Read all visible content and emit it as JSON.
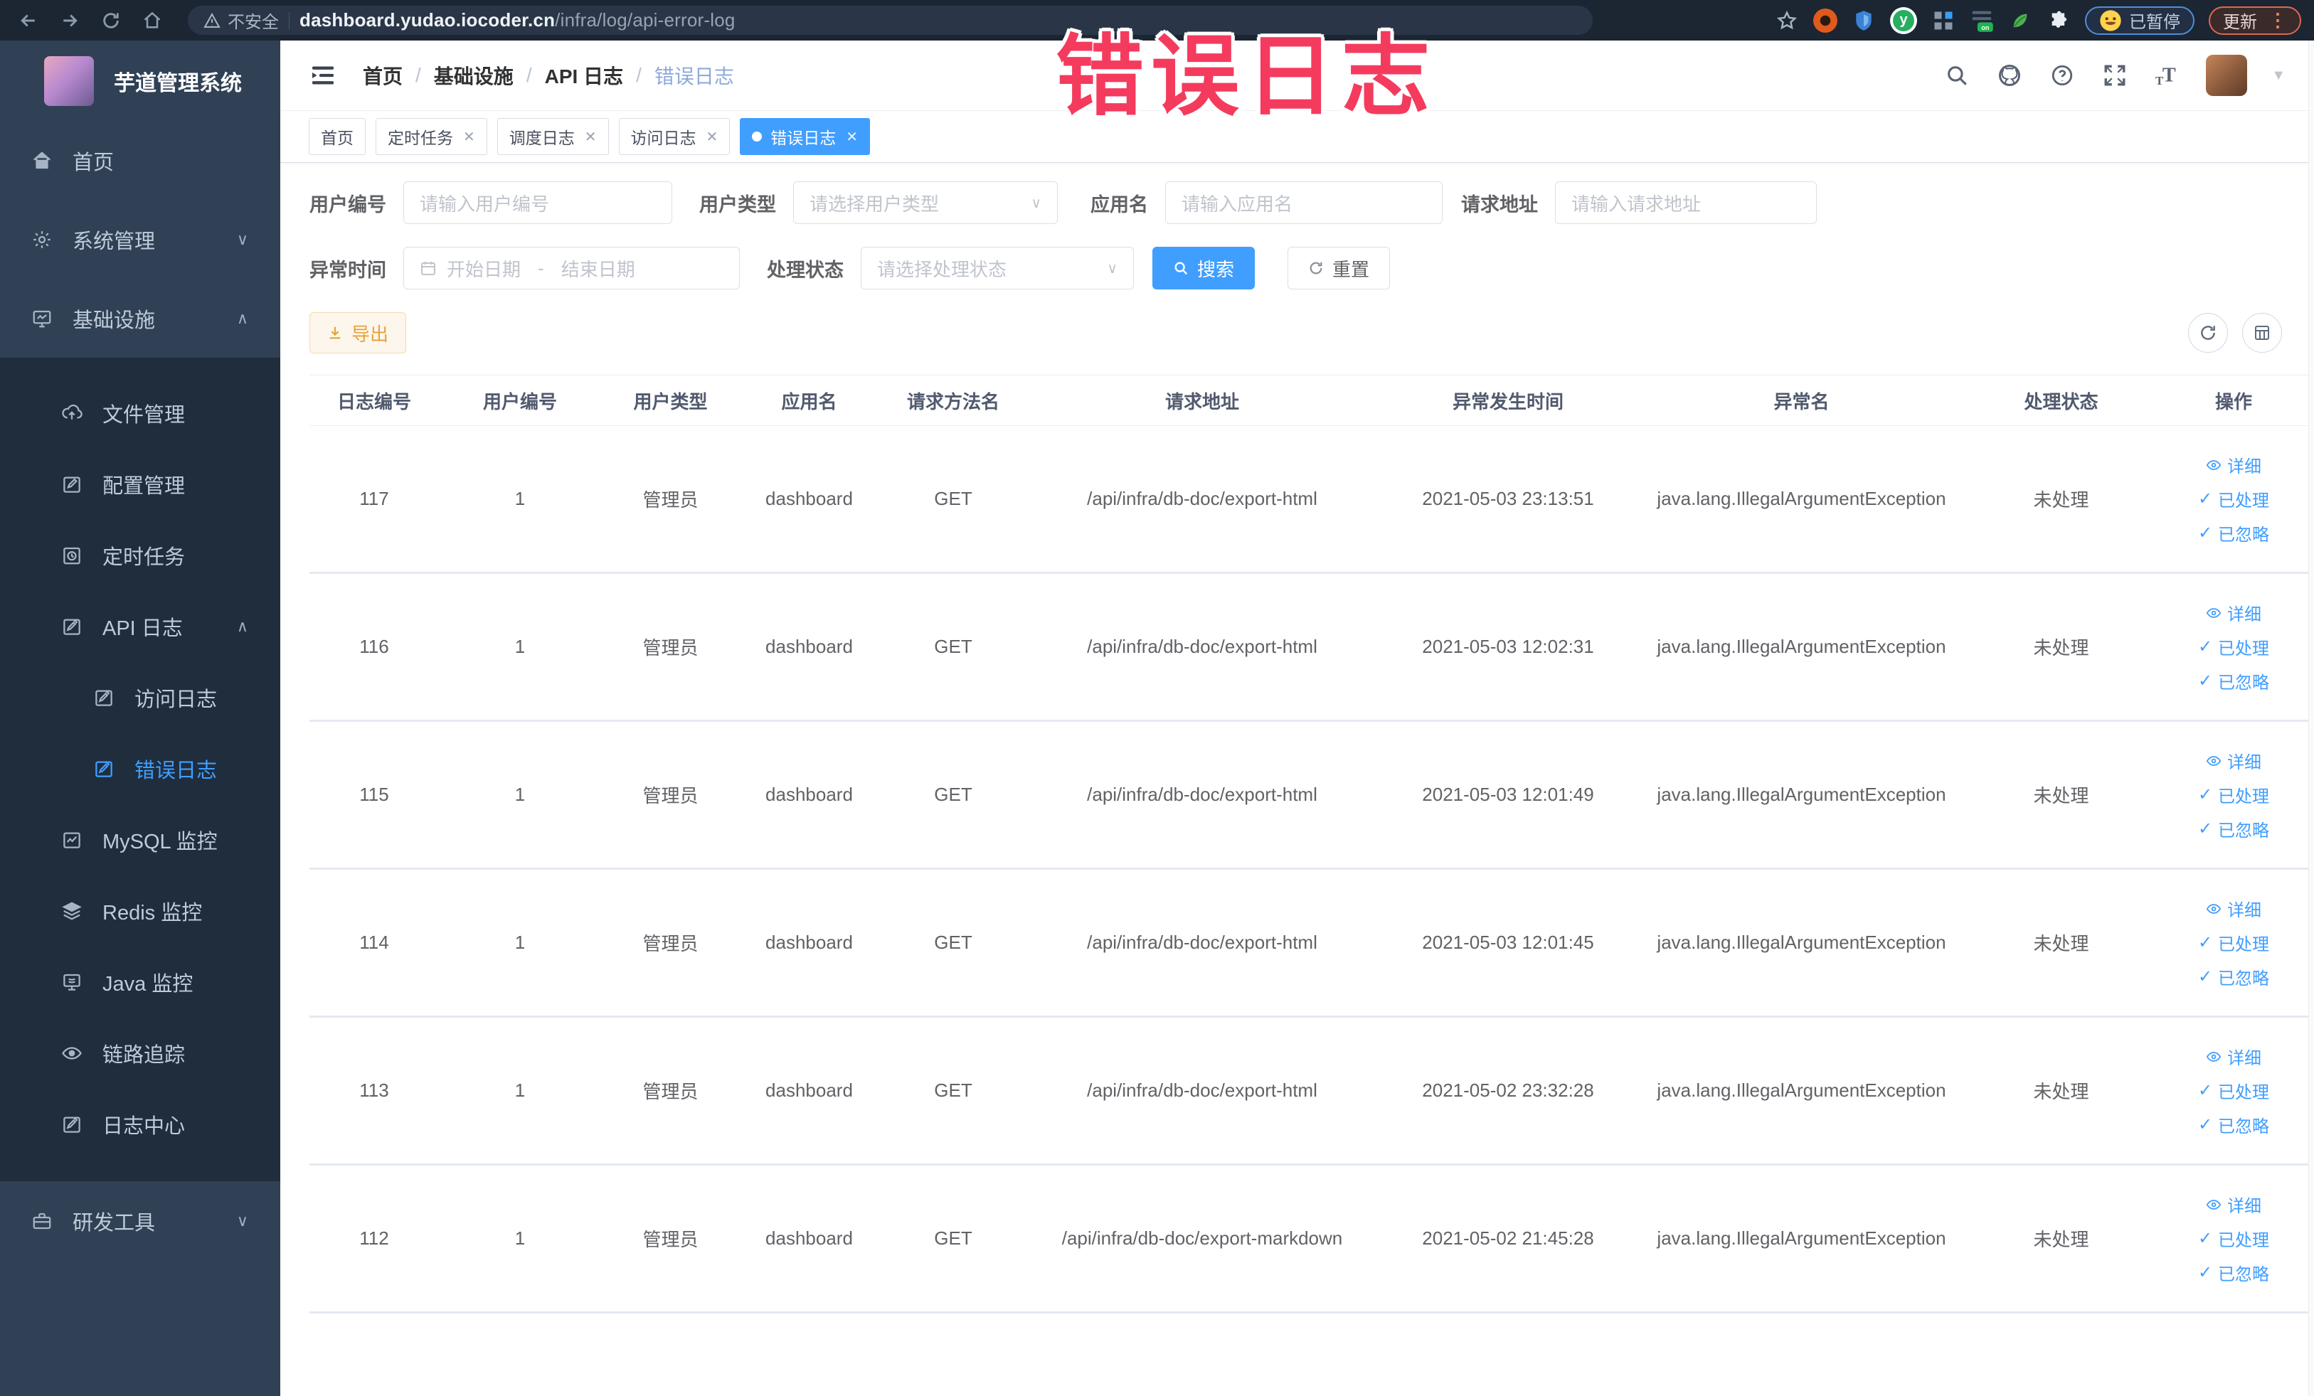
{
  "overlay": {
    "title": "错误日志",
    "color": "#f43b5e"
  },
  "chrome": {
    "security_label": "不安全",
    "url_host": "dashboard.yudao.iocoder.cn",
    "url_path": "/infra/log/api-error-log",
    "paused_label": "已暂停",
    "update_label": "更新",
    "extensions": [
      "bookmark-star",
      "orange-extension",
      "shield-extension",
      "green-y-extension",
      "grid-extension",
      "on-switch-extension",
      "leaf-extension",
      "puzzle-extension"
    ]
  },
  "sidebar": {
    "app_title": "芋道管理系统",
    "items": [
      {
        "label": "首页",
        "icon": "home-icon",
        "level": 0,
        "chevron": "",
        "active": false
      },
      {
        "label": "系统管理",
        "icon": "gear-icon",
        "level": 0,
        "chevron": "down",
        "active": false
      },
      {
        "label": "基础设施",
        "icon": "monitor-icon",
        "level": 0,
        "chevron": "up",
        "active": false
      },
      {
        "label": "文件管理",
        "icon": "cloud-upload-icon",
        "level": 1,
        "chevron": "",
        "active": false
      },
      {
        "label": "配置管理",
        "icon": "edit-icon",
        "level": 1,
        "chevron": "",
        "active": false
      },
      {
        "label": "定时任务",
        "icon": "schedule-icon",
        "level": 1,
        "chevron": "",
        "active": false
      },
      {
        "label": "API 日志",
        "icon": "log-icon",
        "level": 1,
        "chevron": "up",
        "active": false
      },
      {
        "label": "访问日志",
        "icon": "log-icon",
        "level": 2,
        "chevron": "",
        "active": false
      },
      {
        "label": "错误日志",
        "icon": "log-icon",
        "level": 2,
        "chevron": "",
        "active": true
      },
      {
        "label": "MySQL 监控",
        "icon": "chart-icon",
        "level": 1,
        "chevron": "",
        "active": false
      },
      {
        "label": "Redis 监控",
        "icon": "stack-icon",
        "level": 1,
        "chevron": "",
        "active": false
      },
      {
        "label": "Java 监控",
        "icon": "java-icon",
        "level": 1,
        "chevron": "",
        "active": false
      },
      {
        "label": "链路追踪",
        "icon": "eye-icon",
        "level": 1,
        "chevron": "",
        "active": false
      },
      {
        "label": "日志中心",
        "icon": "log-icon",
        "level": 1,
        "chevron": "",
        "active": false
      },
      {
        "label": "研发工具",
        "icon": "toolbox-icon",
        "level": 0,
        "chevron": "down",
        "active": false
      }
    ]
  },
  "navbar": {
    "breadcrumb": [
      "首页",
      "基础设施",
      "API 日志",
      "错误日志"
    ],
    "right_icons": [
      "search-icon",
      "github-icon",
      "help-icon",
      "fullscreen-icon",
      "font-size-icon"
    ]
  },
  "tags": [
    {
      "label": "首页",
      "closable": false,
      "active": false
    },
    {
      "label": "定时任务",
      "closable": true,
      "active": false
    },
    {
      "label": "调度日志",
      "closable": true,
      "active": false
    },
    {
      "label": "访问日志",
      "closable": true,
      "active": false
    },
    {
      "label": "错误日志",
      "closable": true,
      "active": true
    }
  ],
  "filters": {
    "user_id": {
      "label": "用户编号",
      "placeholder": "请输入用户编号"
    },
    "user_type": {
      "label": "用户类型",
      "placeholder": "请选择用户类型"
    },
    "app_name": {
      "label": "应用名",
      "placeholder": "请输入应用名"
    },
    "request_url": {
      "label": "请求地址",
      "placeholder": "请输入请求地址"
    },
    "exception_time": {
      "label": "异常时间",
      "start_placeholder": "开始日期",
      "separator": "-",
      "end_placeholder": "结束日期"
    },
    "process_status": {
      "label": "处理状态",
      "placeholder": "请选择处理状态"
    },
    "search_label": "搜索",
    "reset_label": "重置"
  },
  "toolbar": {
    "export_label": "导出"
  },
  "table": {
    "columns": [
      "日志编号",
      "用户编号",
      "用户类型",
      "应用名",
      "请求方法名",
      "请求地址",
      "异常发生时间",
      "异常名",
      "处理状态",
      "操作"
    ],
    "action_labels": {
      "detail": "详细",
      "processed": "已处理",
      "ignored": "已忽略"
    },
    "rows": [
      {
        "id": "117",
        "user_id": "1",
        "user_type": "管理员",
        "app_name": "dashboard",
        "method": "GET",
        "url": "/api/infra/db-doc/export-html",
        "time": "2021-05-03 23:13:51",
        "exception": "java.lang.IllegalArgumentException",
        "status": "未处理"
      },
      {
        "id": "116",
        "user_id": "1",
        "user_type": "管理员",
        "app_name": "dashboard",
        "method": "GET",
        "url": "/api/infra/db-doc/export-html",
        "time": "2021-05-03 12:02:31",
        "exception": "java.lang.IllegalArgumentException",
        "status": "未处理"
      },
      {
        "id": "115",
        "user_id": "1",
        "user_type": "管理员",
        "app_name": "dashboard",
        "method": "GET",
        "url": "/api/infra/db-doc/export-html",
        "time": "2021-05-03 12:01:49",
        "exception": "java.lang.IllegalArgumentException",
        "status": "未处理"
      },
      {
        "id": "114",
        "user_id": "1",
        "user_type": "管理员",
        "app_name": "dashboard",
        "method": "GET",
        "url": "/api/infra/db-doc/export-html",
        "time": "2021-05-03 12:01:45",
        "exception": "java.lang.IllegalArgumentException",
        "status": "未处理"
      },
      {
        "id": "113",
        "user_id": "1",
        "user_type": "管理员",
        "app_name": "dashboard",
        "method": "GET",
        "url": "/api/infra/db-doc/export-html",
        "time": "2021-05-02 23:32:28",
        "exception": "java.lang.IllegalArgumentException",
        "status": "未处理"
      },
      {
        "id": "112",
        "user_id": "1",
        "user_type": "管理员",
        "app_name": "dashboard",
        "method": "GET",
        "url": "/api/infra/db-doc/export-markdown",
        "time": "2021-05-02 21:45:28",
        "exception": "java.lang.IllegalArgumentException",
        "status": "未处理"
      }
    ]
  }
}
